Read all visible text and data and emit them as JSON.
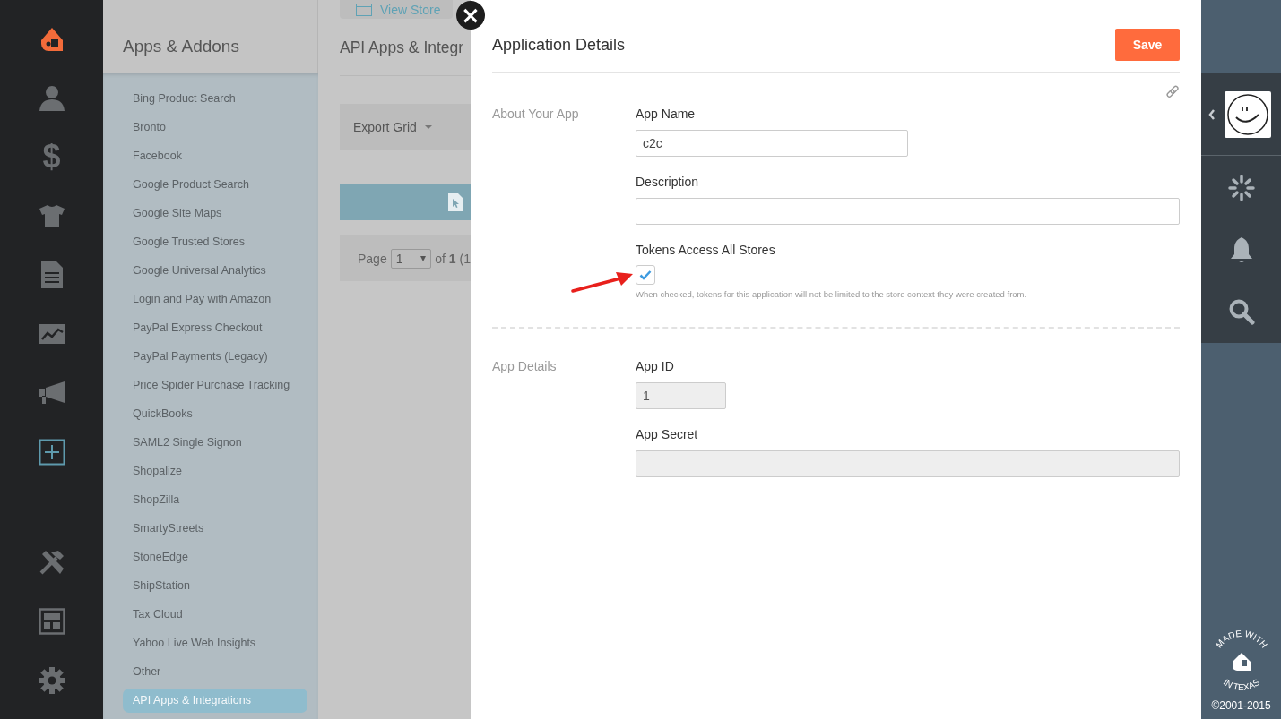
{
  "nav": {
    "top_items": [
      {
        "kind": "person",
        "selected": false
      },
      {
        "kind": "dollar",
        "glyph": "$",
        "selected": false
      },
      {
        "kind": "shirt",
        "selected": false
      },
      {
        "kind": "document",
        "selected": false
      },
      {
        "kind": "chart",
        "selected": false
      },
      {
        "kind": "megaphone",
        "selected": false
      },
      {
        "kind": "apps",
        "selected": true
      }
    ],
    "bottom_items": [
      {
        "kind": "tools",
        "selected": false
      },
      {
        "kind": "layout",
        "selected": false
      },
      {
        "kind": "gear",
        "selected": false
      }
    ]
  },
  "sidebar": {
    "title": "Apps & Addons",
    "items": [
      {
        "label": "Bing Product Search",
        "selected": false
      },
      {
        "label": "Bronto",
        "selected": false
      },
      {
        "label": "Facebook",
        "selected": false
      },
      {
        "label": "Google Product Search",
        "selected": false
      },
      {
        "label": "Google Site Maps",
        "selected": false
      },
      {
        "label": "Google Trusted Stores",
        "selected": false
      },
      {
        "label": "Google Universal Analytics",
        "selected": false
      },
      {
        "label": "Login and Pay with Amazon",
        "selected": false
      },
      {
        "label": "PayPal Express Checkout",
        "selected": false
      },
      {
        "label": "PayPal Payments (Legacy)",
        "selected": false
      },
      {
        "label": "Price Spider Purchase Tracking",
        "selected": false
      },
      {
        "label": "QuickBooks",
        "selected": false
      },
      {
        "label": "SAML2 Single Signon",
        "selected": false
      },
      {
        "label": "Shopalize",
        "selected": false
      },
      {
        "label": "ShopZilla",
        "selected": false
      },
      {
        "label": "SmartyStreets",
        "selected": false
      },
      {
        "label": "StoneEdge",
        "selected": false
      },
      {
        "label": "ShipStation",
        "selected": false
      },
      {
        "label": "Tax Cloud",
        "selected": false
      },
      {
        "label": "Yahoo Live Web Insights",
        "selected": false
      },
      {
        "label": "Other",
        "selected": false
      },
      {
        "label": "API Apps & Integrations",
        "selected": true
      }
    ]
  },
  "main": {
    "view_store": "View Store",
    "title": "API Apps & Integr",
    "export": "Export Grid",
    "pager": {
      "label": "Page",
      "value": "1",
      "total": "of **1** (1"
    }
  },
  "modal": {
    "close": "×",
    "title": "Application Details",
    "save": "Save",
    "sections": [
      {
        "label": "About Your App",
        "fields": [
          {
            "kind": "text",
            "label": "App Name",
            "value": "c2c",
            "disabled": false
          },
          {
            "kind": "text",
            "label": "Description",
            "disabled": false
          },
          {
            "kind": "checkbox",
            "label": "Tokens Access All Stores",
            "checked": true,
            "help": "When checked, tokens for this application will not be limited to the store context they were created from."
          }
        ]
      },
      {
        "label": "App Details",
        "fields": [
          {
            "kind": "text",
            "label": "App ID",
            "value": "1",
            "disabled": true
          },
          {
            "kind": "secret",
            "label": "App Secret",
            "disabled": true
          }
        ]
      }
    ]
  },
  "rail": {
    "badge_top": "MADE WITH",
    "badge_bottom": "IN TEXAS",
    "copyright": "©2001-2015"
  }
}
